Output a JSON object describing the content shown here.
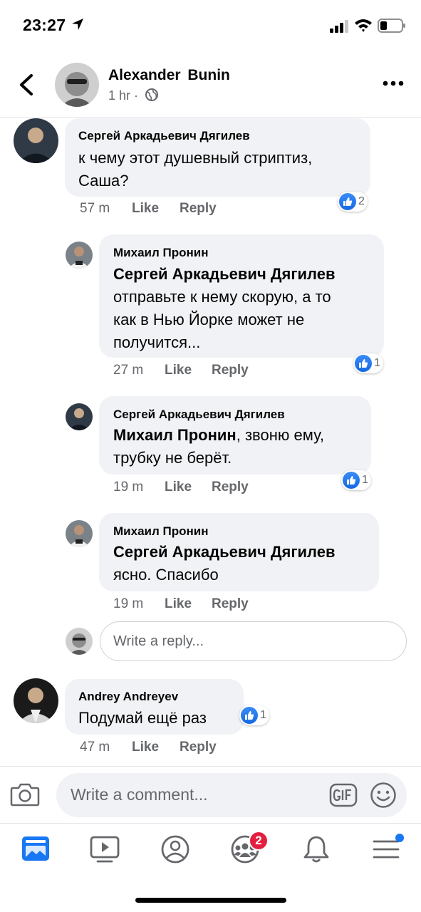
{
  "status_bar": {
    "time": "23:27"
  },
  "header": {
    "author": "Alexander  Bunin",
    "post_time": "1 hr ·"
  },
  "comments": [
    {
      "name": "Сергей Аркадьевич Дягилев",
      "line1": "к чему этот душевный стриптиз,",
      "line2": "Саша?",
      "time": "57 m",
      "like": "Like",
      "reply": "Reply",
      "reactions": "2"
    },
    {
      "name": "Михаил Пронин",
      "mention": "Сергей Аркадьевич Дягилев",
      "line1": "отправьте к нему скорую, а то",
      "line2": "как в Нью Йорке может не",
      "line3": "получится...",
      "time": "27 m",
      "like": "Like",
      "reply": "Reply",
      "reactions": "1"
    },
    {
      "name": "Сергей Аркадьевич Дягилев",
      "mention": "Михаил Пронин",
      "line1_rest": ", звоню ему,",
      "line2": "трубку не берёт.",
      "time": "19 m",
      "like": "Like",
      "reply": "Reply",
      "reactions": "1"
    },
    {
      "name": "Михаил Пронин",
      "mention": "Сергей Аркадьевич Дягилев",
      "line1": "ясно. Спасибо",
      "time": "19 m",
      "like": "Like",
      "reply": "Reply"
    },
    {
      "name": "Andrey Andreyev",
      "line1": "Подумай ещё раз",
      "time": "47 m",
      "like": "Like",
      "reply": "Reply",
      "reactions": "1"
    }
  ],
  "reply_input": {
    "placeholder": "Write a reply..."
  },
  "comment_input": {
    "placeholder": "Write a comment..."
  },
  "tab_bar": {
    "friends_badge": "2"
  },
  "colors": {
    "accent": "#1877f2",
    "bubble": "#f0f2f5",
    "meta": "#65676b",
    "badge": "#e41e3f"
  }
}
